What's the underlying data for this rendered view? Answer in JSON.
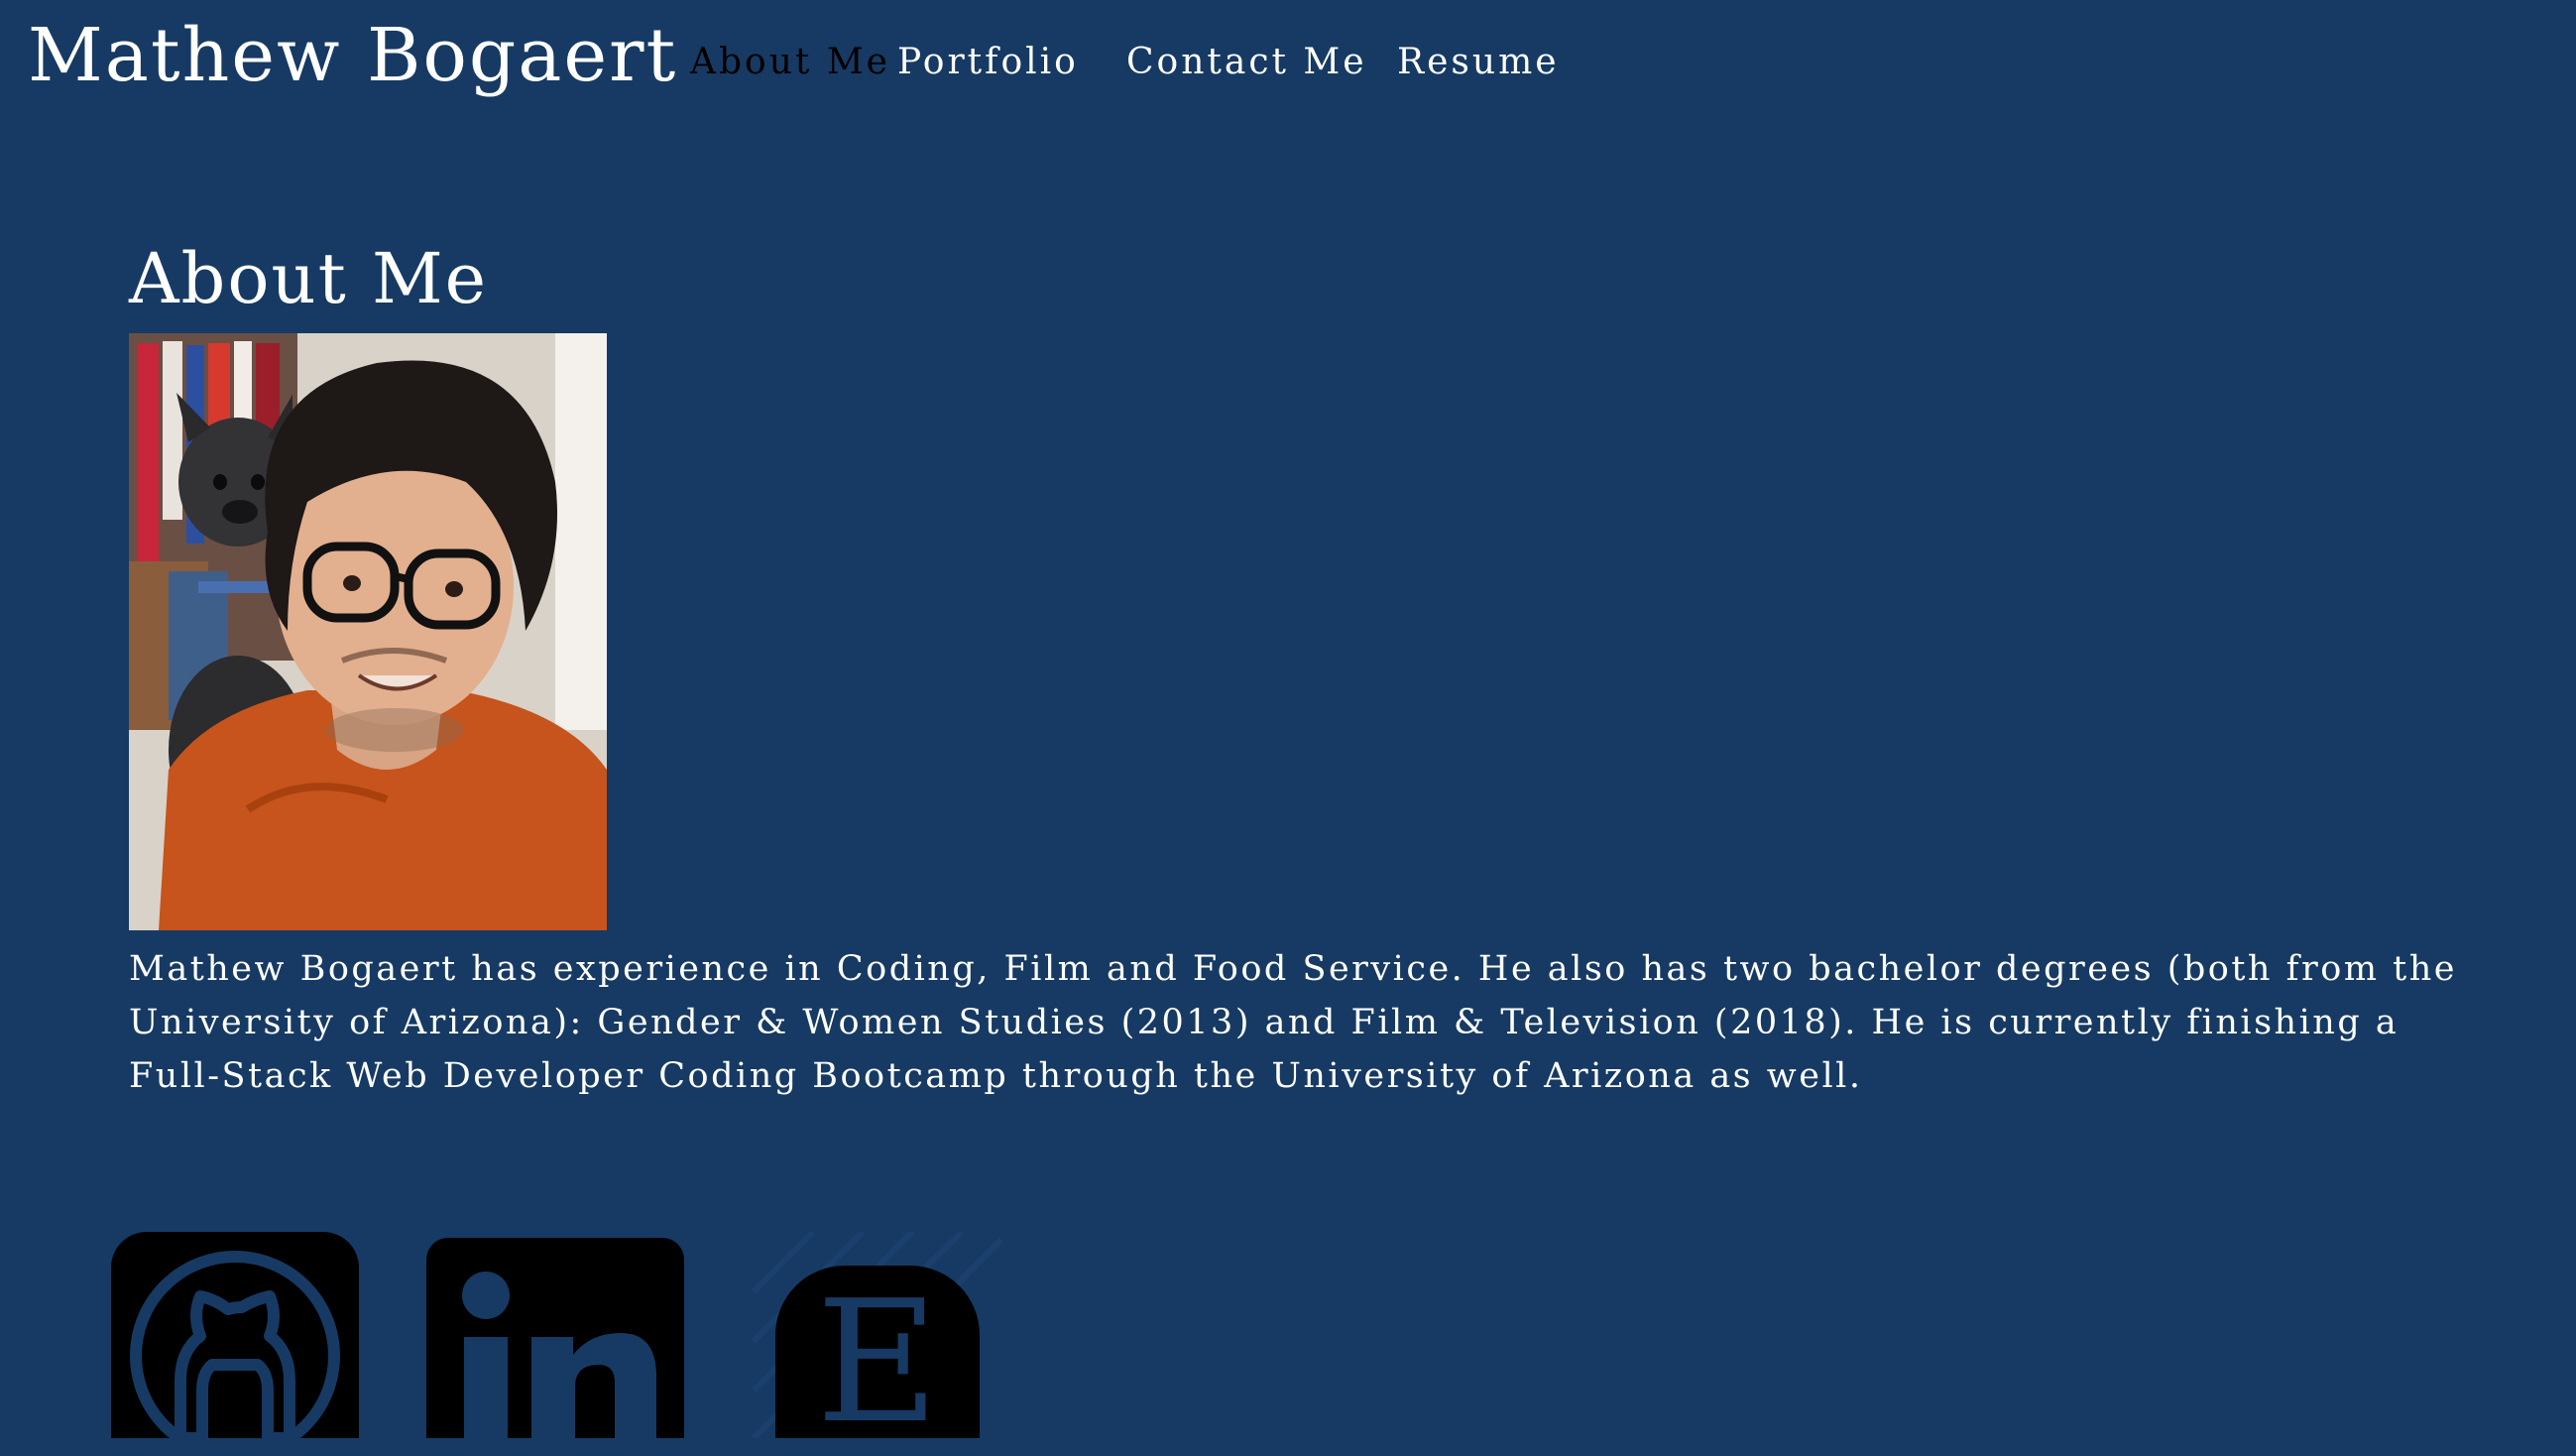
{
  "header": {
    "site_title": "Mathew Bogaert",
    "nav": [
      {
        "label": "About Me",
        "active": true
      },
      {
        "label": "Portfolio",
        "active": false
      },
      {
        "label": "Contact Me",
        "active": false
      },
      {
        "label": "Resume",
        "active": false
      }
    ]
  },
  "main": {
    "section_title": "About Me",
    "photo_icon": "profile-photo",
    "bio": "Mathew Bogaert has experience in Coding, Film and Food Service. He also has two bachelor degrees (both from the University of Arizona): Gender & Women Studies (2013) and Film & Television (2018). He is currently finishing a Full-Stack Web Developer Coding Bootcamp through the University of Arizona as well."
  },
  "social": [
    {
      "icon": "github-icon"
    },
    {
      "icon": "linkedin-icon"
    },
    {
      "icon": "etsy-icon"
    }
  ],
  "colors": {
    "background": "#163a63",
    "text": "#ffffff",
    "active_nav": "#000000",
    "icon": "#000000"
  }
}
